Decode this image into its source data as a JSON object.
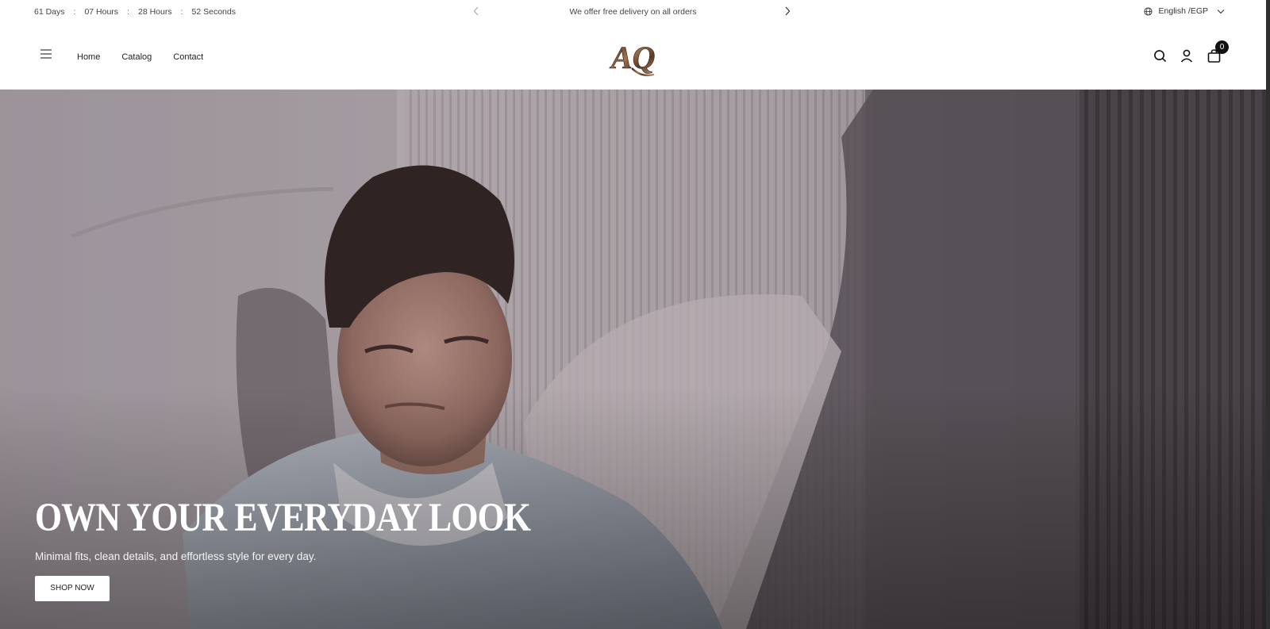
{
  "topbar": {
    "countdown": [
      {
        "value": "61 Days"
      },
      {
        "value": "07 Hours"
      },
      {
        "value": "28 Hours"
      },
      {
        "value": "52 Seconds"
      }
    ],
    "separator": ":",
    "announcement": "We offer free delivery on all orders",
    "language": "English /EGP"
  },
  "header": {
    "nav": [
      "Home",
      "Catalog",
      "Contact"
    ],
    "logo_text": "AQ",
    "cart_count": "0"
  },
  "hero": {
    "title": "OWN YOUR EVERYDAY LOOK",
    "subtitle": "Minimal fits, clean details, and effortless style for every day.",
    "cta": "SHOP NOW"
  }
}
